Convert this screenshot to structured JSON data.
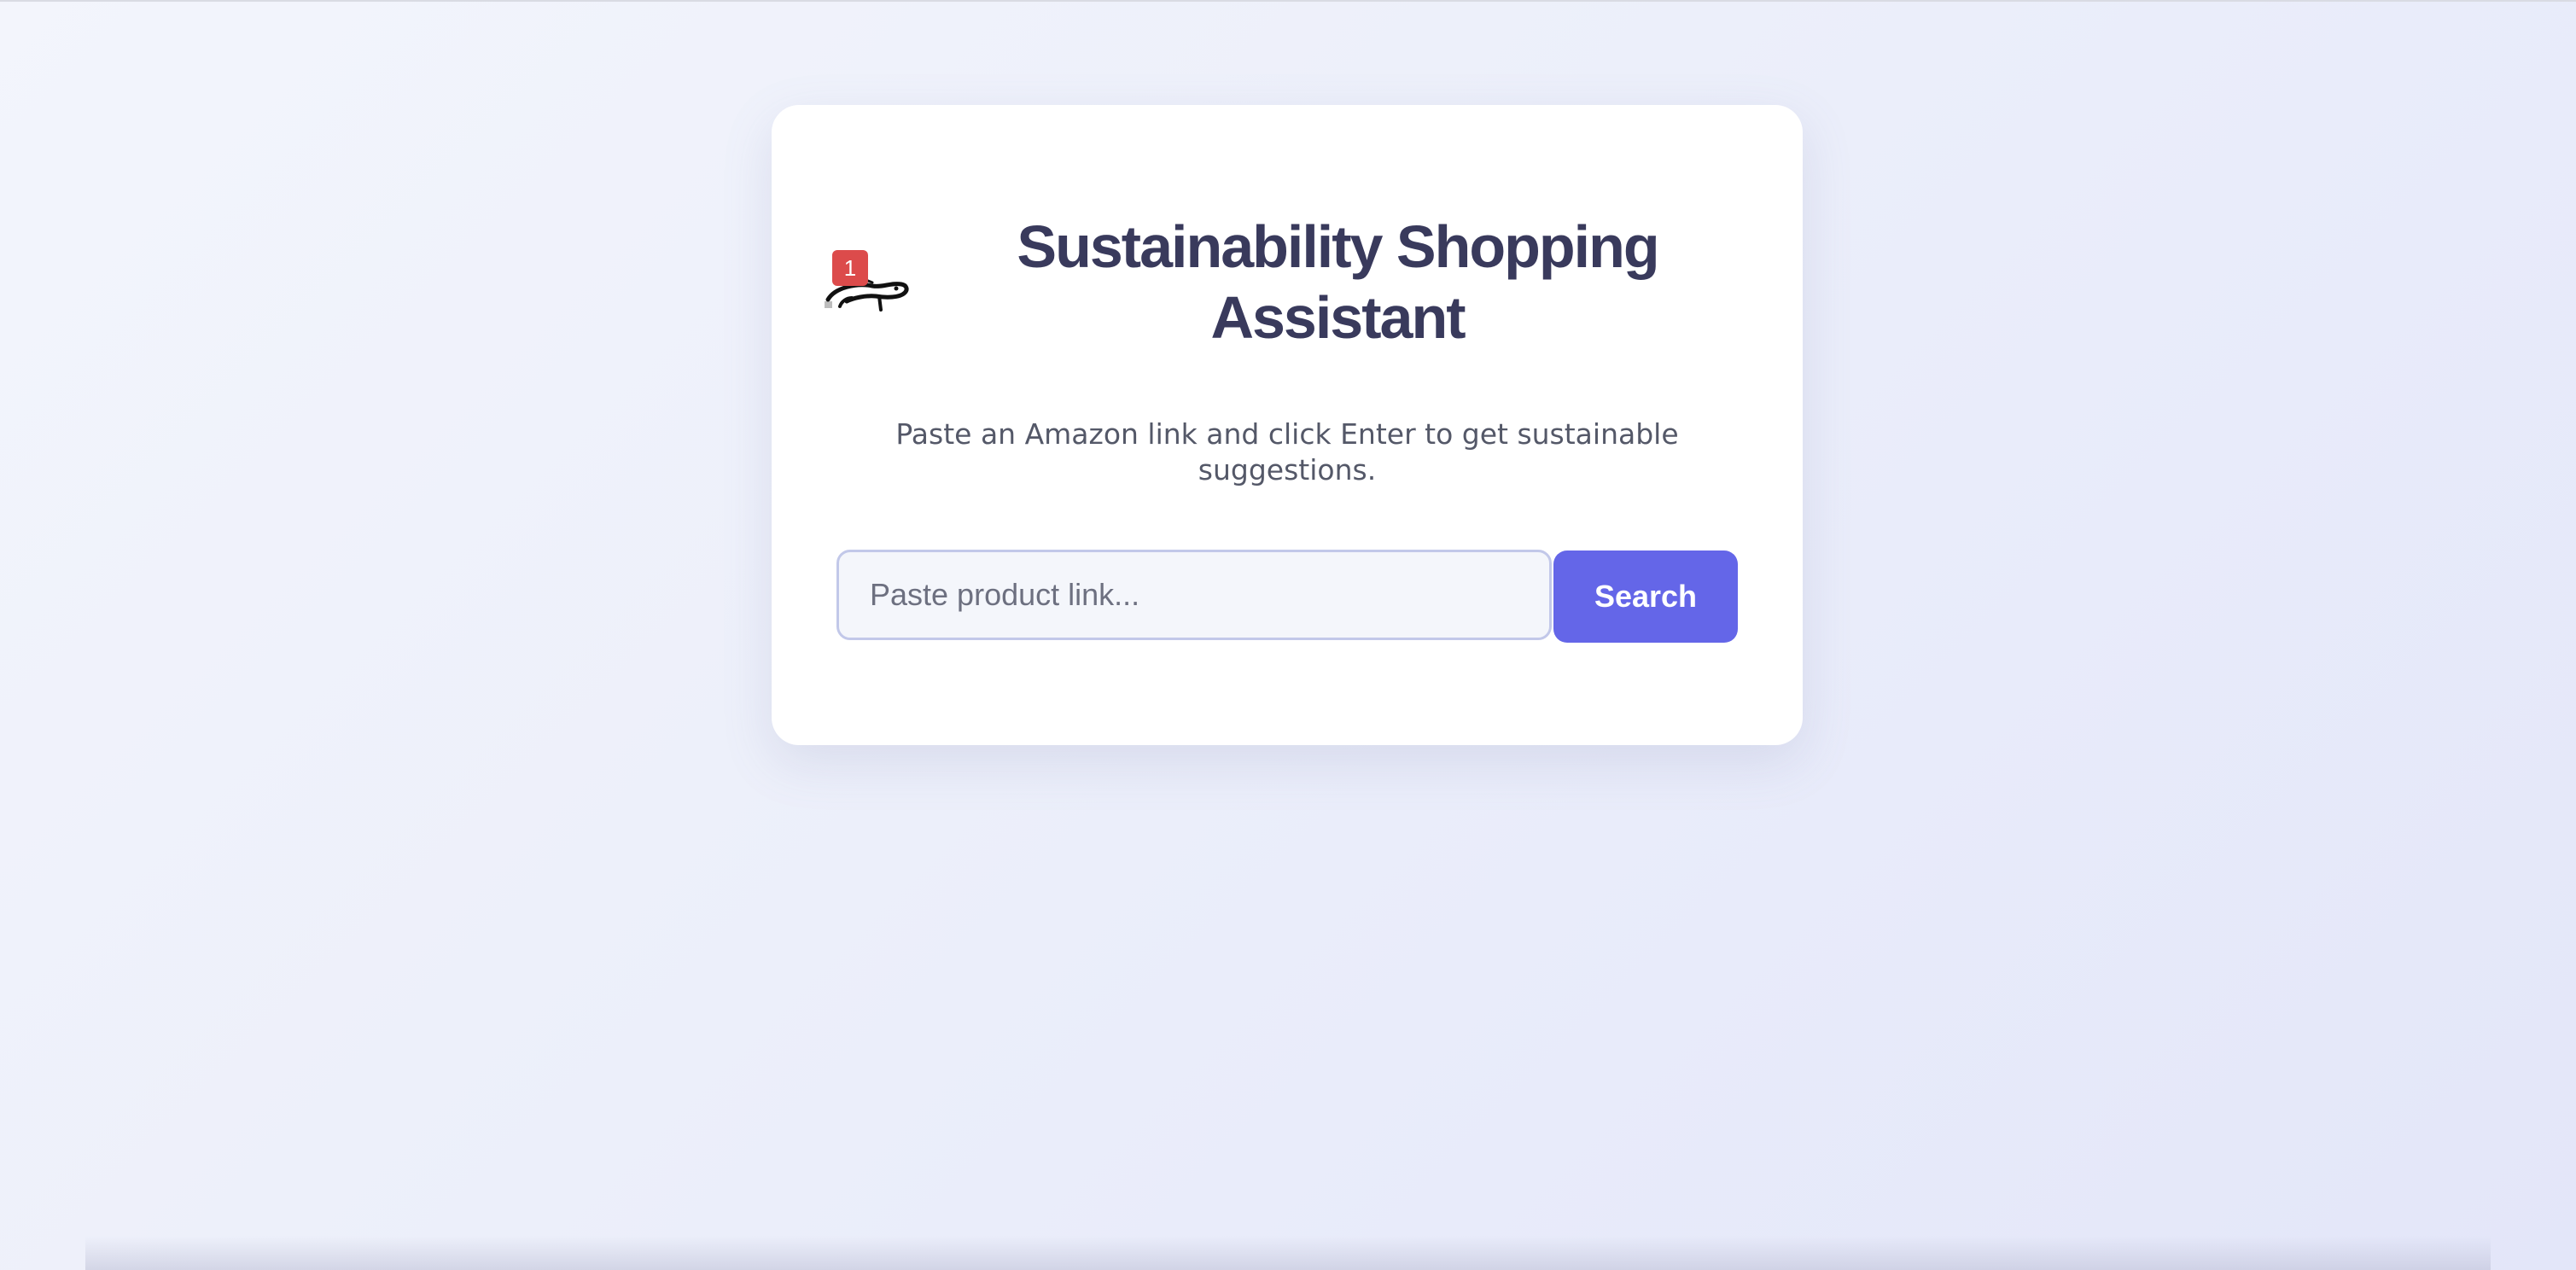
{
  "header": {
    "title": "Sustainability Shopping Assistant",
    "notification_count": "1",
    "logo_icon": "salamander-icon"
  },
  "main": {
    "subtitle": "Paste an Amazon link and click Enter to get sustainable suggestions."
  },
  "search": {
    "placeholder": "Paste product link...",
    "value": "",
    "button_label": "Search"
  },
  "colors": {
    "accent": "#6466e8",
    "title": "#393a5c",
    "badge": "#dc4b4b",
    "background": "#eceffa"
  }
}
